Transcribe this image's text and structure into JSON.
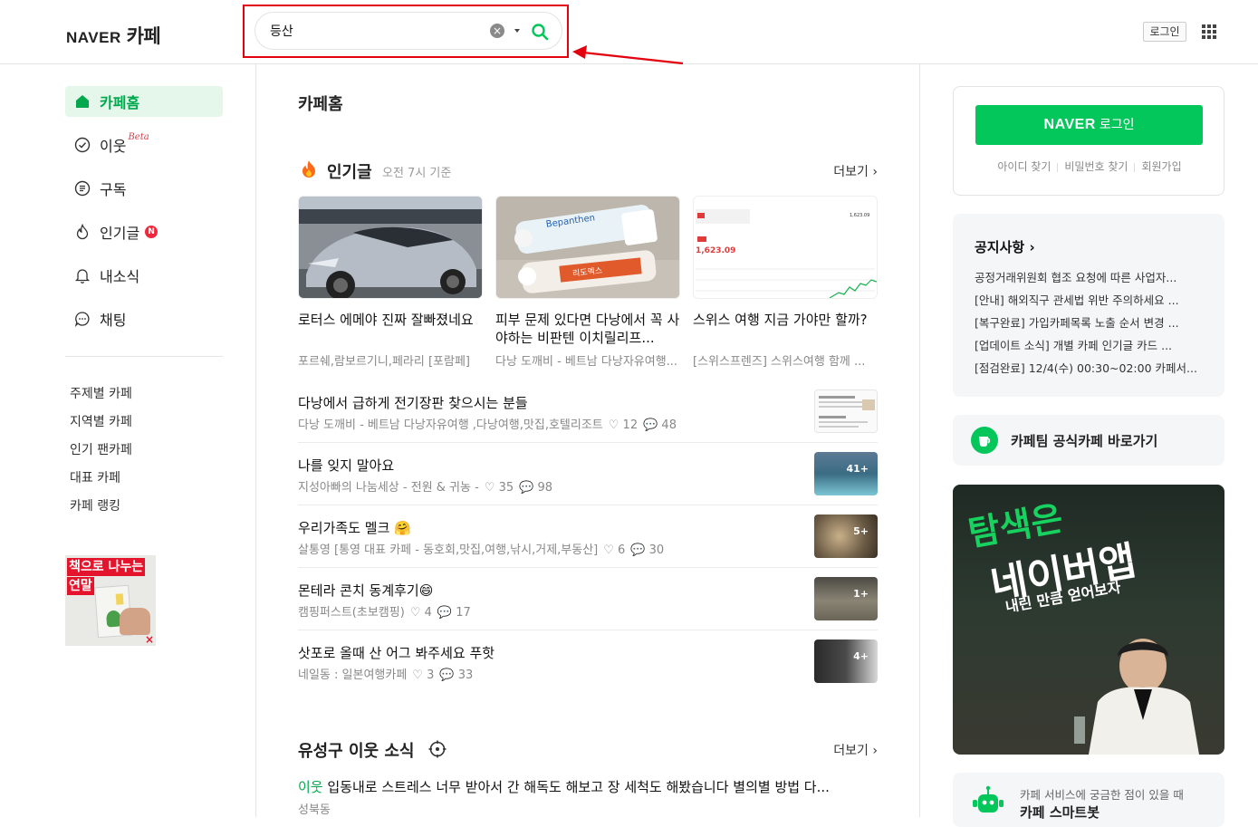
{
  "header": {
    "logo_naver": "NAVER",
    "logo_cafe": "카페",
    "search_value": "등산",
    "login_label": "로그인"
  },
  "icons": [
    "home-icon",
    "check-circle-icon",
    "subscribe-icon",
    "fire-icon",
    "bell-icon",
    "chat-icon",
    "search-icon",
    "clear-icon",
    "grid-icon",
    "chevron-right-icon",
    "target-icon",
    "robot-icon"
  ],
  "colors": {
    "brand_green": "#03c75a",
    "accent_green": "#00a84d",
    "highlight_red": "#e3000f"
  },
  "nav": {
    "items": [
      {
        "label": "카페홈"
      },
      {
        "label": "이웃",
        "tag": "Beta"
      },
      {
        "label": "구독"
      },
      {
        "label": "인기글",
        "badge": "N"
      },
      {
        "label": "내소식"
      },
      {
        "label": "채팅"
      }
    ],
    "sub": [
      "주제별 카페",
      "지역별 카페",
      "인기 팬카페",
      "대표 카페",
      "카페 랭킹"
    ]
  },
  "left_ad": {
    "line1": "책으로 나누는",
    "line2": "연말",
    "close": "×"
  },
  "main": {
    "page_title": "카페홈",
    "popular": {
      "title": "인기글",
      "subtitle": "오전 7시 기준",
      "more": "더보기"
    },
    "cards": [
      {
        "title": "로터스 에메야 진짜 잘빠졌네요",
        "meta": "포르쉐,람보르기니,페라리 [포람페]"
      },
      {
        "title": "피부 문제 있다면 다낭에서 꼭 사야하는 비판텐 이치릴리프...",
        "meta": "다낭 도깨비 - 베트남 다낭자유여행..."
      },
      {
        "title": "스위스 여행 지금 가야만 할까?",
        "meta": "[스위스프렌즈] 스위스여행 함께 ..."
      }
    ],
    "card_thumb_texts": {
      "tube1": "Bepanthen",
      "tube2": "리도멕스",
      "chart_price": "1,623.09",
      "chart_top": "1,623.09"
    },
    "list": [
      {
        "title": "다낭에서 급하게 전기장판 찾으시는 분들",
        "cafe": "다낭 도깨비 - 베트남 다낭자유여행 ,다낭여행,맛집,호텔리조트",
        "likes": "12",
        "comments": "48",
        "count": ""
      },
      {
        "title": "나를 잊지 말아요",
        "cafe": "지성아빠의 나눔세상 - 전원 & 귀농 -",
        "likes": "35",
        "comments": "98",
        "count": "41+"
      },
      {
        "title": "우리가족도 멜크 🤗",
        "cafe": "살통영 [통영 대표 카페 - 동호회,맛집,여행,낚시,거제,부동산]",
        "likes": "6",
        "comments": "30",
        "count": "5+"
      },
      {
        "title": "몬테라 콘치 동계후기😄",
        "cafe": "캠핑퍼스트(초보캠핑)",
        "likes": "4",
        "comments": "17",
        "count": "1+"
      },
      {
        "title": "삿포로 올때 산 어그 봐주세요 푸핫",
        "cafe": "네일동 : 일본여행카페",
        "likes": "3",
        "comments": "33",
        "count": "4+"
      }
    ],
    "neighbor": {
      "title": "유성구 이웃 소식",
      "more": "더보기",
      "item_tag": "이웃",
      "item_text": "입동내로 스트레스 너무 받아서 간 해독도 해보고 장 세척도 해봤습니다 별의별 방법 다...",
      "item_loc": "성북동"
    }
  },
  "right": {
    "login_naver": "NAVER",
    "login_text": "로그인",
    "links": [
      "아이디 찾기",
      "비밀번호 찾기",
      "회원가입"
    ],
    "notice_title": "공지사항",
    "notices": [
      "공정거래위원회 협조 요청에 따른 사업자...",
      "[안내] 해외직구 관세법 위반 주의하세요 ...",
      "[복구완료] 가입카페목록 노출 순서 변경 ...",
      "[업데이트 소식] 개별 카페 인기글 카드 ...",
      "[점검완료] 12/4(수) 00:30~02:00 카페서..."
    ],
    "official": "카페팀 공식카페 바로가기",
    "ad_line1": "탐색은",
    "ad_line2": "네이버앱",
    "ad_line3": "내린 만큼 얻어보자",
    "smart_line1": "카페 서비스에 궁금한 점이 있을 때",
    "smart_line2": "카페 스마트봇"
  }
}
